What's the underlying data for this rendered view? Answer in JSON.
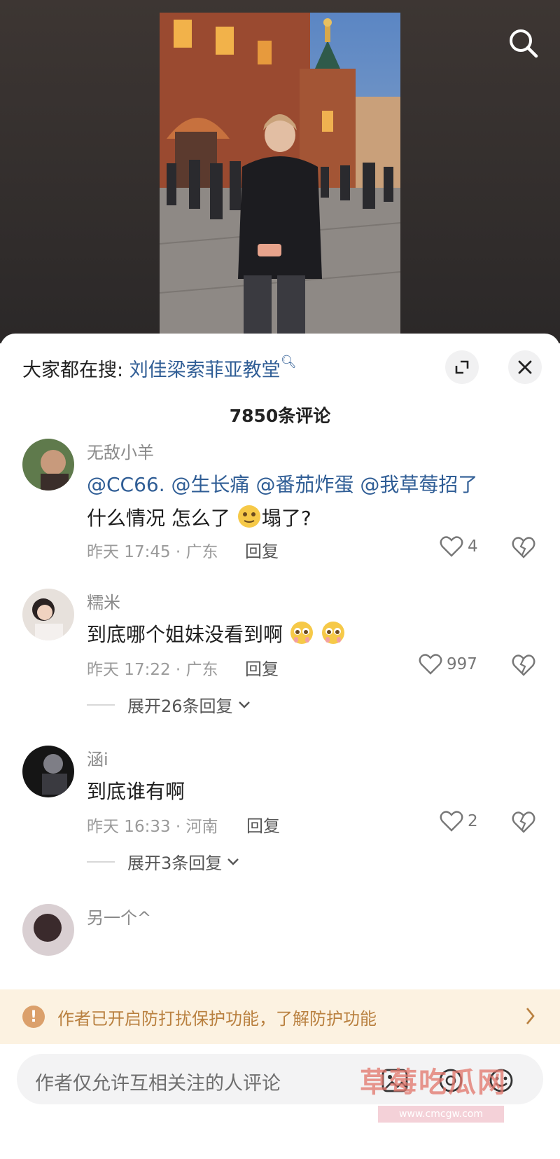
{
  "hot_search": {
    "prefix": "大家都在搜: ",
    "term": "刘佳梁索菲亚教堂"
  },
  "comment_count": "7850条评论",
  "comments": [
    {
      "username": "无敌小羊",
      "mentions": [
        "@CC66.",
        "@生长痛",
        "@番茄炸蛋",
        "@我草莓招了"
      ],
      "text": "什么情况 怎么了",
      "text_tail": "塌了?",
      "meta": "昨天 17:45 · 广东",
      "reply_label": "回复",
      "likes": "4"
    },
    {
      "username": "糯米",
      "text": "到底哪个姐妹没看到啊",
      "meta": "昨天 17:22 · 广东",
      "reply_label": "回复",
      "likes": "997",
      "expand_label": "展开26条回复"
    },
    {
      "username": "涵i",
      "text": "到底谁有啊",
      "meta": "昨天 16:33 · 河南",
      "reply_label": "回复",
      "likes": "2",
      "expand_label": "展开3条回复"
    },
    {
      "username": "另一个^"
    }
  ],
  "banner": {
    "text": "作者已开启防打扰保护功能，了解防护功能"
  },
  "input": {
    "placeholder": "作者仅允许互相关注的人评论"
  },
  "watermark": {
    "text": "草莓吃瓜网",
    "url": "www.cmcgw.com"
  },
  "colors": {
    "link": "#2f5d95",
    "banner_bg": "#fcf2e1",
    "banner_text": "#b9803f"
  }
}
